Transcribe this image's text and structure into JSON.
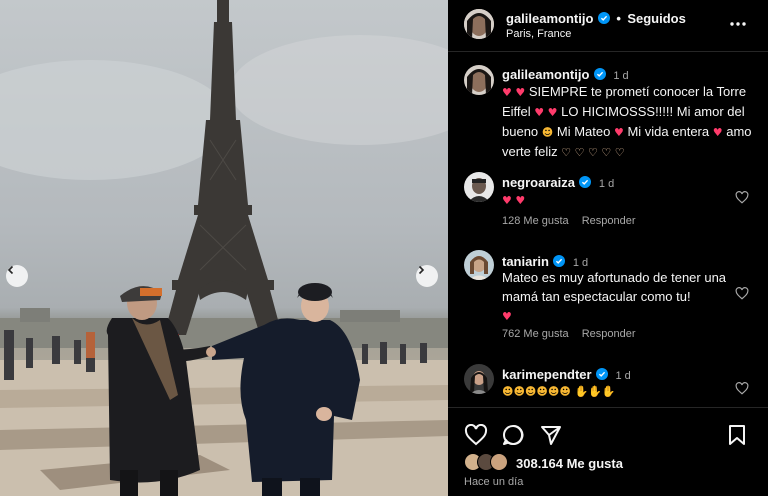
{
  "header": {
    "username": "galileamontijo",
    "separator": "•",
    "follow_status": "Seguidos",
    "location": "Paris, France",
    "more_icon": "more-horizontal-icon"
  },
  "caption": {
    "username": "galileamontijo",
    "time": "1 d",
    "text_1": "SIEMPRE te prometí conocer la Torre Eiffel",
    "text_2": "LO HICIMOSSS!!!!! Mi amor del bueno",
    "text_3": "Mi Mateo",
    "text_4": "Mi vida entera",
    "text_5": "amo verte feliz"
  },
  "comments": [
    {
      "username": "negroaraiza",
      "time": "1 d",
      "text": "",
      "likes": "128 Me gusta",
      "reply": "Responder"
    },
    {
      "username": "taniarin",
      "time": "1 d",
      "text": "Mateo es muy afortunado de tener una mamá tan espectacular como tu!",
      "likes": "762 Me gusta",
      "reply": "Responder"
    },
    {
      "username": "karimependter",
      "time": "1 d",
      "text": ""
    }
  ],
  "footer": {
    "likes": "308.164 Me gusta",
    "posted": "Hace un día"
  },
  "colors": {
    "background": "#000000",
    "verified": "#0095f6",
    "heart_emoji": "#ff3b6b",
    "text_muted": "#a8a8a8"
  },
  "icons": [
    "heart-icon",
    "comment-icon",
    "share-icon",
    "bookmark-icon",
    "chevron-left-icon",
    "chevron-right-icon"
  ]
}
